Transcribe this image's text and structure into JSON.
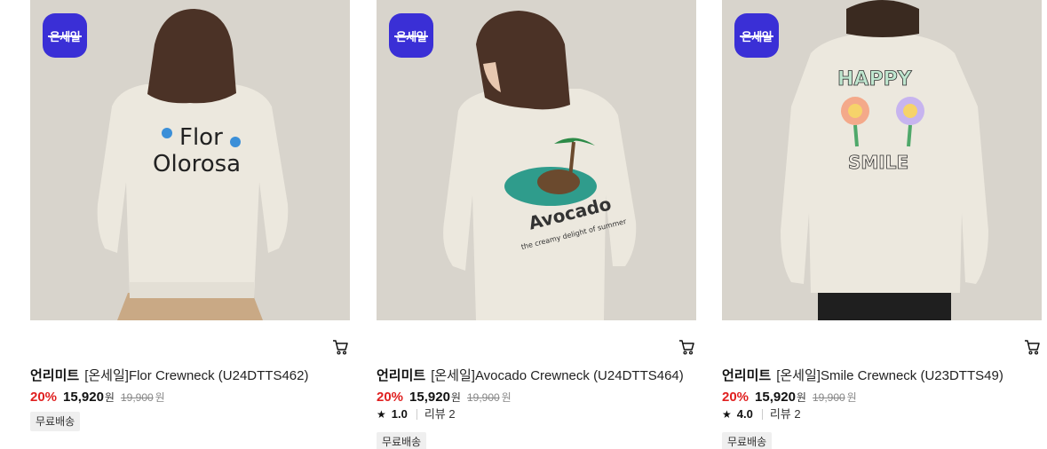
{
  "products": [
    {
      "badge": "온세일",
      "brand": "언리미트",
      "name": "[온세일]Flor Crewneck (U24DTTS462)",
      "discount": "20%",
      "price": "15,920",
      "price_unit": "원",
      "original_price": "19,900",
      "original_unit": "원",
      "rating": null,
      "reviews": null,
      "shipping": "무료배송",
      "print_text": [
        "Flor",
        "Olorosa"
      ]
    },
    {
      "badge": "온세일",
      "brand": "언리미트",
      "name": "[온세일]Avocado Crewneck (U24DTTS464)",
      "discount": "20%",
      "price": "15,920",
      "price_unit": "원",
      "original_price": "19,900",
      "original_unit": "원",
      "rating": "1.0",
      "reviews": "리뷰 2",
      "shipping": "무료배송",
      "print_text": [
        "Avocado",
        "the creamy delight of summer"
      ]
    },
    {
      "badge": "온세일",
      "brand": "언리미트",
      "name": "[온세일]Smile Crewneck (U23DTTS49)",
      "discount": "20%",
      "price": "15,920",
      "price_unit": "원",
      "original_price": "19,900",
      "original_unit": "원",
      "rating": "4.0",
      "reviews": "리뷰 2",
      "shipping": "무료배송",
      "print_text": [
        "HAPPY",
        "SMILE"
      ]
    }
  ],
  "colors": {
    "badge": "#3a2fd6",
    "discount": "#e02020",
    "background": "#d8d4cc",
    "sweatshirt": "#ece8de"
  },
  "icons": {
    "cart": "cart-icon",
    "star": "star-icon"
  }
}
